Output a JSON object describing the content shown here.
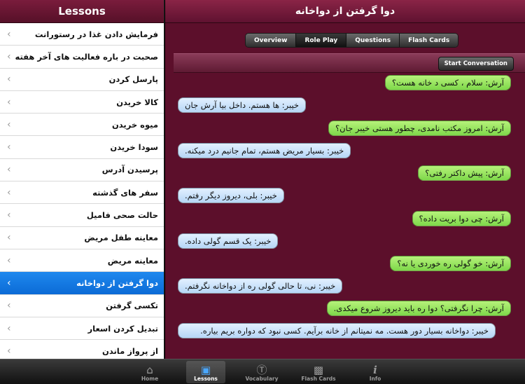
{
  "left": {
    "title": "Lessons",
    "items": [
      {
        "label": "فرمایش دادن غذا در رستورانت"
      },
      {
        "label": "صحبت در باره فعالیت های آخر هفته"
      },
      {
        "label": "پارسل کردن"
      },
      {
        "label": "کالا خریدن"
      },
      {
        "label": "میوه خریدن"
      },
      {
        "label": "سودا خریدن"
      },
      {
        "label": "پرسیدن آدرس"
      },
      {
        "label": "سفر های گذشته"
      },
      {
        "label": "حالت صحی فامیل"
      },
      {
        "label": "معاینه طفل مریض"
      },
      {
        "label": "معاینه مریض"
      },
      {
        "label": "دوا گرفتن از دواخانه"
      },
      {
        "label": "تکسی گرفتن"
      },
      {
        "label": "تبدیل کردن اسعار"
      },
      {
        "label": "از پرواز ماندن"
      }
    ],
    "chevron": "›"
  },
  "right": {
    "title": "دوا گرفتن از دواخانه",
    "tabs": [
      {
        "label": "Overview"
      },
      {
        "label": "Role Play"
      },
      {
        "label": "Questions"
      },
      {
        "label": "Flash Cards"
      }
    ],
    "start_button": "Start Conversation",
    "messages": [
      {
        "text": "آرش: سلام ، کسی د خانه هست؟"
      },
      {
        "text": "خیبر: ها هستم. داخل بیا آرش جان"
      },
      {
        "text": "آرش: امروز مکتب نامدی، چطور هستی خیبر جان؟"
      },
      {
        "text": "خیبر: بسیار مریض هستم، تمام جانیم درد میکنه."
      },
      {
        "text": "آرش: پیش داکتر رفتی؟"
      },
      {
        "text": "خیبر: بلی، دیروز دیگر رفتم."
      },
      {
        "text": "آرش: چی دوا بریت داده؟"
      },
      {
        "text": "خیبر: یک قسم گولی داده."
      },
      {
        "text": "آرش: خو گولی ره خوردی یا نه؟"
      },
      {
        "text": "خیبر: نی، تا حالی گولی ره از دواخانه نگرفتم."
      },
      {
        "text": "آرش: چرا نگرفتی؟ دوا ره باید دیروز شروع میکدی."
      },
      {
        "text": "خیبر: دواخانه بسیار دور هست. مه نمیتانم از خانه برآیم. کسی نبود که  دواره بریم بیاره."
      }
    ]
  },
  "tabbar": {
    "items": [
      {
        "label": "Home",
        "icon": "home-icon"
      },
      {
        "label": "Lessons",
        "icon": "book-icon"
      },
      {
        "label": "Vocabulary",
        "icon": "v-icon"
      },
      {
        "label": "Flash Cards",
        "icon": "cards-icon"
      },
      {
        "label": "Info",
        "icon": "info-icon"
      }
    ]
  },
  "colors": {
    "accent_blue": "#0b6bd6",
    "maroon": "#5c0f2b",
    "green_bubble": "#7ed84a",
    "blue_bubble": "#b6d6f6"
  }
}
